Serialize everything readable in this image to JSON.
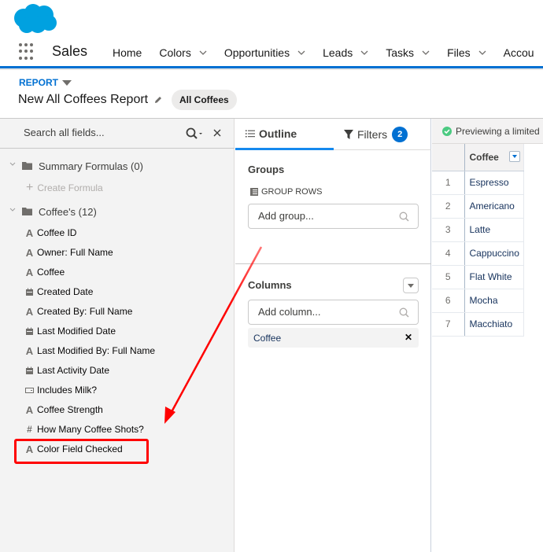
{
  "app": {
    "logo_icon": "salesforce-cloud-logo",
    "name": "Sales",
    "launcher_icon": "app-launcher-waffle-icon",
    "brand_color": "#0070d2"
  },
  "nav": {
    "items": [
      {
        "label": "Home",
        "has_menu": false
      },
      {
        "label": "Colors",
        "has_menu": true
      },
      {
        "label": "Opportunities",
        "has_menu": true
      },
      {
        "label": "Leads",
        "has_menu": true
      },
      {
        "label": "Tasks",
        "has_menu": true
      },
      {
        "label": "Files",
        "has_menu": true
      },
      {
        "label": "Accou",
        "has_menu": false
      }
    ]
  },
  "header": {
    "object_label": "REPORT",
    "title": "New All Coffees Report",
    "report_type_pill": "All Coffees"
  },
  "fields_panel": {
    "search_placeholder": "Search all fields...",
    "folders": [
      {
        "label": "Summary Formulas (0)"
      },
      {
        "label": "Coffee's (12)"
      }
    ],
    "create_formula_label": "Create Formula",
    "fields": [
      {
        "label": "Coffee ID",
        "type": "text"
      },
      {
        "label": "Owner: Full Name",
        "type": "text"
      },
      {
        "label": "Coffee",
        "type": "text"
      },
      {
        "label": "Created Date",
        "type": "date"
      },
      {
        "label": "Created By: Full Name",
        "type": "text"
      },
      {
        "label": "Last Modified Date",
        "type": "date"
      },
      {
        "label": "Last Modified By: Full Name",
        "type": "text"
      },
      {
        "label": "Last Activity Date",
        "type": "date"
      },
      {
        "label": "Includes Milk?",
        "type": "checkbox"
      },
      {
        "label": "Coffee Strength",
        "type": "text"
      },
      {
        "label": "How Many Coffee Shots?",
        "type": "number"
      },
      {
        "label": "Color Field Checked",
        "type": "text",
        "highlighted": true
      }
    ],
    "highlight_color": "#ff0000"
  },
  "outline_panel": {
    "tabs": {
      "outline": "Outline",
      "filters": "Filters",
      "filters_count": "2"
    },
    "groups": {
      "title": "Groups",
      "group_rows_label": "GROUP ROWS",
      "add_placeholder": "Add group..."
    },
    "columns": {
      "title": "Columns",
      "add_placeholder": "Add column...",
      "items": [
        "Coffee"
      ]
    }
  },
  "preview": {
    "status_text": "Previewing a limited",
    "column_header": "Coffee",
    "rows": [
      {
        "num": "1",
        "coffee": "Espresso"
      },
      {
        "num": "2",
        "coffee": "Americano"
      },
      {
        "num": "3",
        "coffee": "Latte"
      },
      {
        "num": "4",
        "coffee": "Cappuccino"
      },
      {
        "num": "5",
        "coffee": "Flat White"
      },
      {
        "num": "6",
        "coffee": "Mocha"
      },
      {
        "num": "7",
        "coffee": "Macchiato"
      }
    ]
  },
  "annotation": {
    "arrow_color": "#ff0000"
  }
}
